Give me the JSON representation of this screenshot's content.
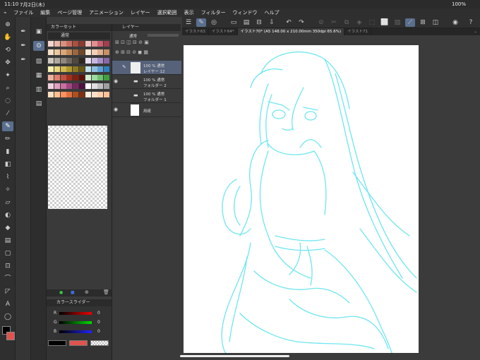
{
  "status": {
    "time": "11:10",
    "date": "7月2日(木)",
    "battery": "100%"
  },
  "menu": [
    "ファイル",
    "編集",
    "ページ管理",
    "アニメーション",
    "レイヤー",
    "選択範囲",
    "表示",
    "フィルター",
    "ウィンドウ",
    "ヘルプ"
  ],
  "tabs": [
    "イラスト63",
    "イラスト64*",
    "イラスト70* (A5 148.00 x 210.00mm 350dpi 65.6%)",
    "イラスト71"
  ],
  "colorset": {
    "title": "カラーセット",
    "set_name": "通常"
  },
  "layer": {
    "title": "レイヤー",
    "blend": "通常"
  },
  "layers": [
    {
      "mode": "100 % 通常",
      "name": "レイヤー 12",
      "selected": true
    },
    {
      "mode": "100 % 通常",
      "name": "フォルダー 2",
      "selected": false
    },
    {
      "mode": "100 % 通常",
      "name": "フォルダー 1",
      "selected": false
    },
    {
      "mode": "",
      "name": "用紙",
      "selected": false
    }
  ],
  "slider": {
    "title": "カラースライダー",
    "r_label": "R",
    "g_label": "G",
    "b_label": "B",
    "r": "0",
    "g": "0",
    "b": "0"
  },
  "colors": {
    "accent": "#5a6f8e",
    "sketch": "#6ee6ef",
    "main": "#000000",
    "sub": "#e0534e"
  }
}
